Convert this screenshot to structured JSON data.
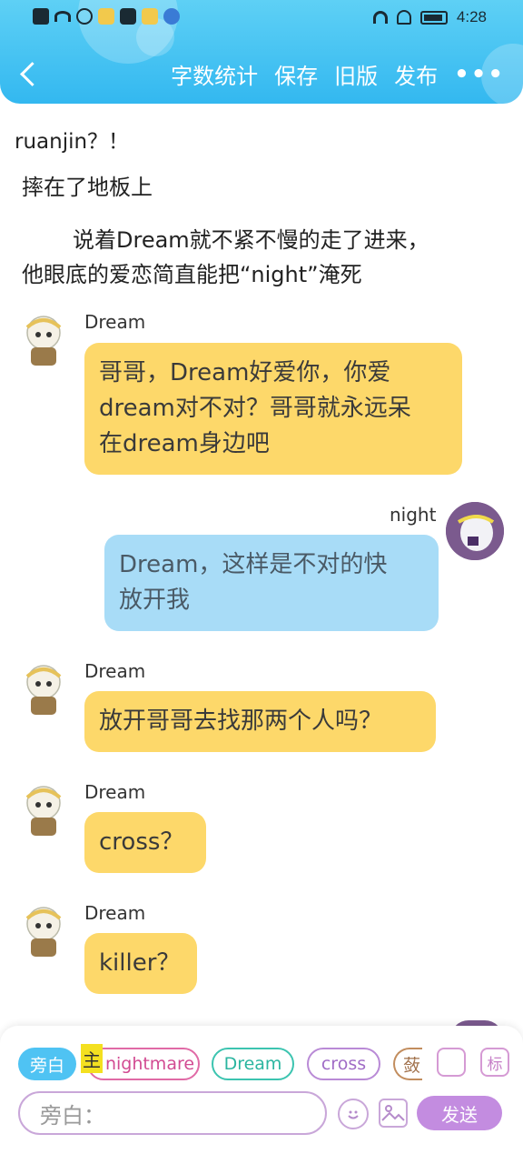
{
  "status_bar": {
    "time": "4:28",
    "left_icons": [
      "alert-icon",
      "wifi-icon",
      "k-icon",
      "weibo-icon",
      "app-icon",
      "weibo-icon",
      "browser-icon"
    ],
    "right_icons": [
      "headphone-icon",
      "mute-icon",
      "battery-icon"
    ]
  },
  "header": {
    "back_label": "",
    "actions": {
      "word_count": "字数统计",
      "save": "保存",
      "old_version": "旧版",
      "publish": "发布",
      "more": "•••"
    },
    "colors": {
      "top": "#5ed0f5",
      "bottom": "#33b8f0"
    }
  },
  "narration": {
    "line1": "ruanjin？！",
    "line2": "摔在了地板上",
    "line3": "说着Dream就不紧不慢的走了进来，",
    "line4": "他眼底的爱恋简直能把“night”淹死"
  },
  "messages": [
    {
      "speaker": "Dream",
      "side": "left",
      "lines": [
        "哥哥，Dream好爱你，你爱",
        "dream对不对？哥哥就永远呆",
        "在dream身边吧"
      ]
    },
    {
      "speaker": "night",
      "side": "right",
      "lines": [
        "Dream，这样是不对的快",
        "放开我"
      ]
    },
    {
      "speaker": "Dream",
      "side": "left",
      "lines": [
        "放开哥哥去找那两个人吗？"
      ]
    },
    {
      "speaker": "Dream",
      "side": "left",
      "lines": [
        "cross？"
      ]
    },
    {
      "speaker": "Dream",
      "side": "left",
      "lines": [
        "killer？"
      ]
    }
  ],
  "input_panel": {
    "roles": {
      "narration": "旁白",
      "main_tag": "主",
      "nightmare": "nightmare",
      "dream": "Dream",
      "cross": "cross",
      "more": "蔹"
    },
    "tool_profile": "",
    "tool_mark": "标",
    "placeholder": "旁白：",
    "send": "发送",
    "colors": {
      "accent": "#c38ce0",
      "narration_chip": "#4fc3f3"
    }
  }
}
